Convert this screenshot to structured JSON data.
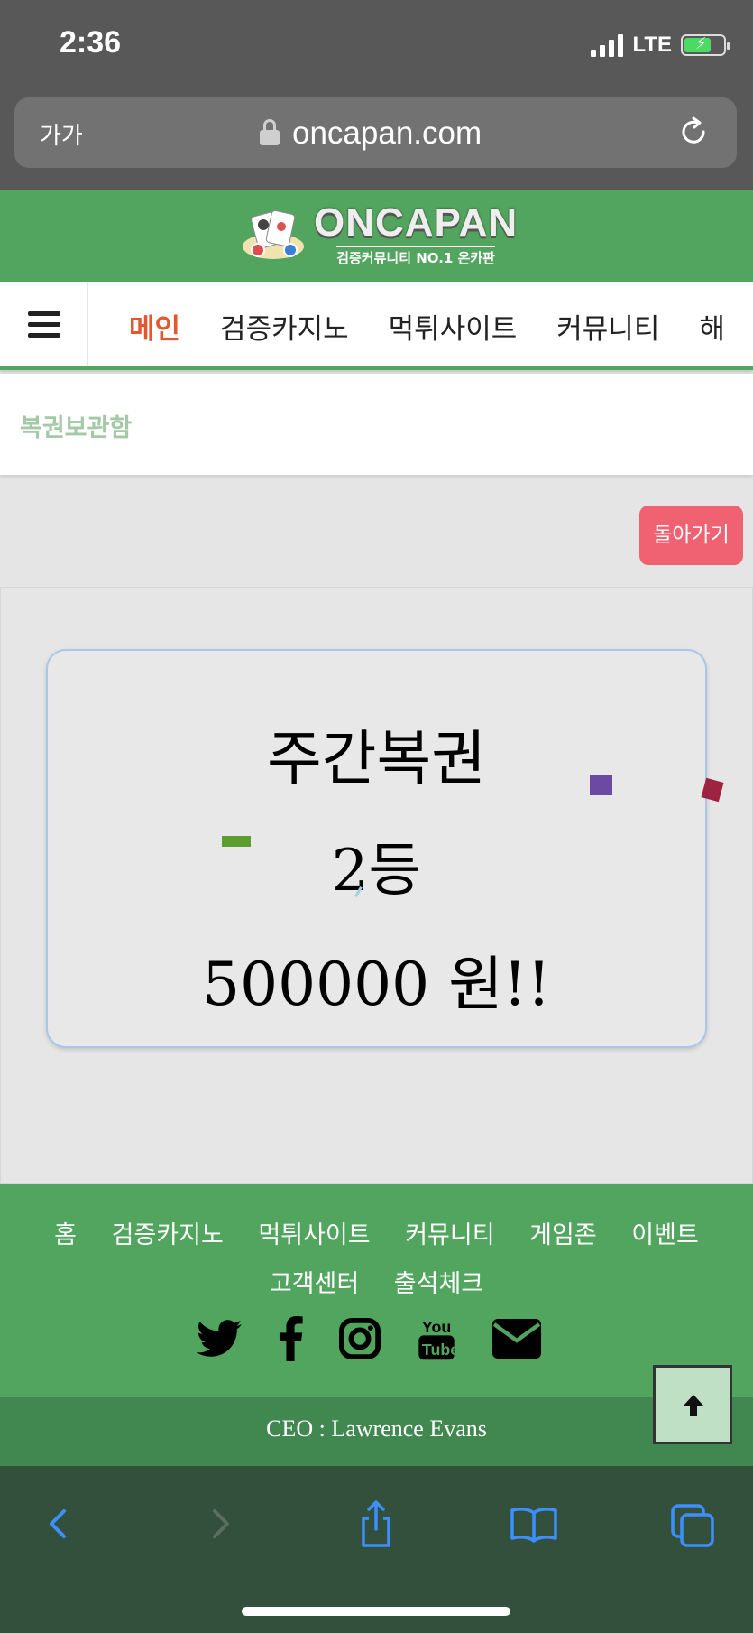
{
  "status_bar": {
    "time": "2:36",
    "network": "LTE"
  },
  "url_bar": {
    "text_size_label": "가가",
    "url": "oncapan.com"
  },
  "site": {
    "logo_text": "ONCAPAN",
    "logo_sub": "검증커뮤니티 NO.1 온카판",
    "brand_color": "#52a55e"
  },
  "nav": {
    "items": [
      "메인",
      "검증카지노",
      "먹튀사이트",
      "커뮤니티",
      "해"
    ]
  },
  "page": {
    "title": "복권보관함",
    "back_label": "돌아가기"
  },
  "prize": {
    "title": "주간복권",
    "rank": "2등",
    "amount": "500000 원!!"
  },
  "footer": {
    "links_row1": [
      "홈",
      "검증카지노",
      "먹튀사이트",
      "커뮤니티",
      "게임존",
      "이벤트"
    ],
    "links_row2": [
      "고객센터",
      "출석체크"
    ],
    "social_icons": [
      "twitter-icon",
      "facebook-icon",
      "instagram-icon",
      "youtube-icon",
      "email-icon"
    ],
    "ceo": "CEO : Lawrence Evans"
  },
  "toolbar": {
    "icons": [
      "back-icon",
      "forward-icon",
      "share-icon",
      "bookmarks-icon",
      "tabs-icon"
    ]
  }
}
